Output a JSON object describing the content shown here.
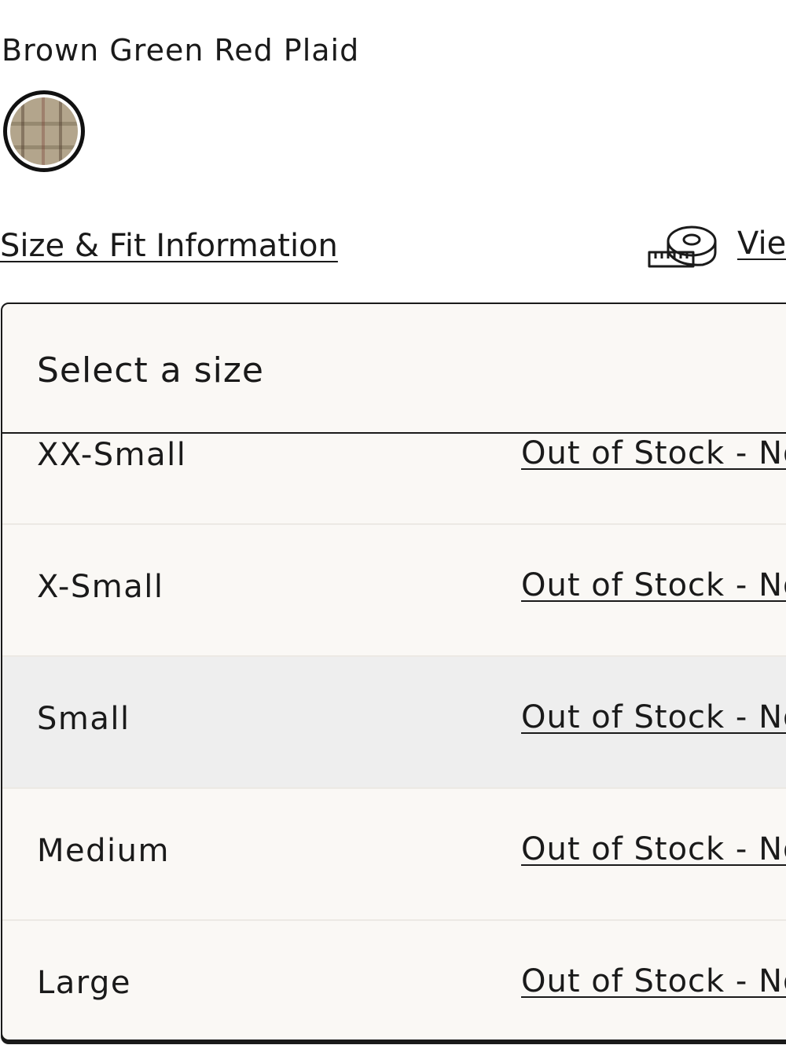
{
  "product": {
    "color_name": "Brown Green Red Plaid",
    "swatch_icon": "plaid-swatch"
  },
  "links": {
    "size_fit": "Size & Fit Information",
    "view": "Vie",
    "tape_icon": "measuring-tape-icon"
  },
  "size_panel": {
    "title": "Select a size",
    "sizes": [
      {
        "label": "XX-Small",
        "status": "Out of Stock - No"
      },
      {
        "label": "X-Small",
        "status": "Out of Stock - No"
      },
      {
        "label": "Small",
        "status": "Out of Stock - No"
      },
      {
        "label": "Medium",
        "status": "Out of Stock - No"
      },
      {
        "label": "Large",
        "status": "Out of Stock - No"
      }
    ]
  },
  "colors": {
    "text": "#1a1a1a",
    "panel_bg": "#faf8f5",
    "row_hover_bg": "#eeeeee",
    "swatch_base": "#b3a58c"
  }
}
